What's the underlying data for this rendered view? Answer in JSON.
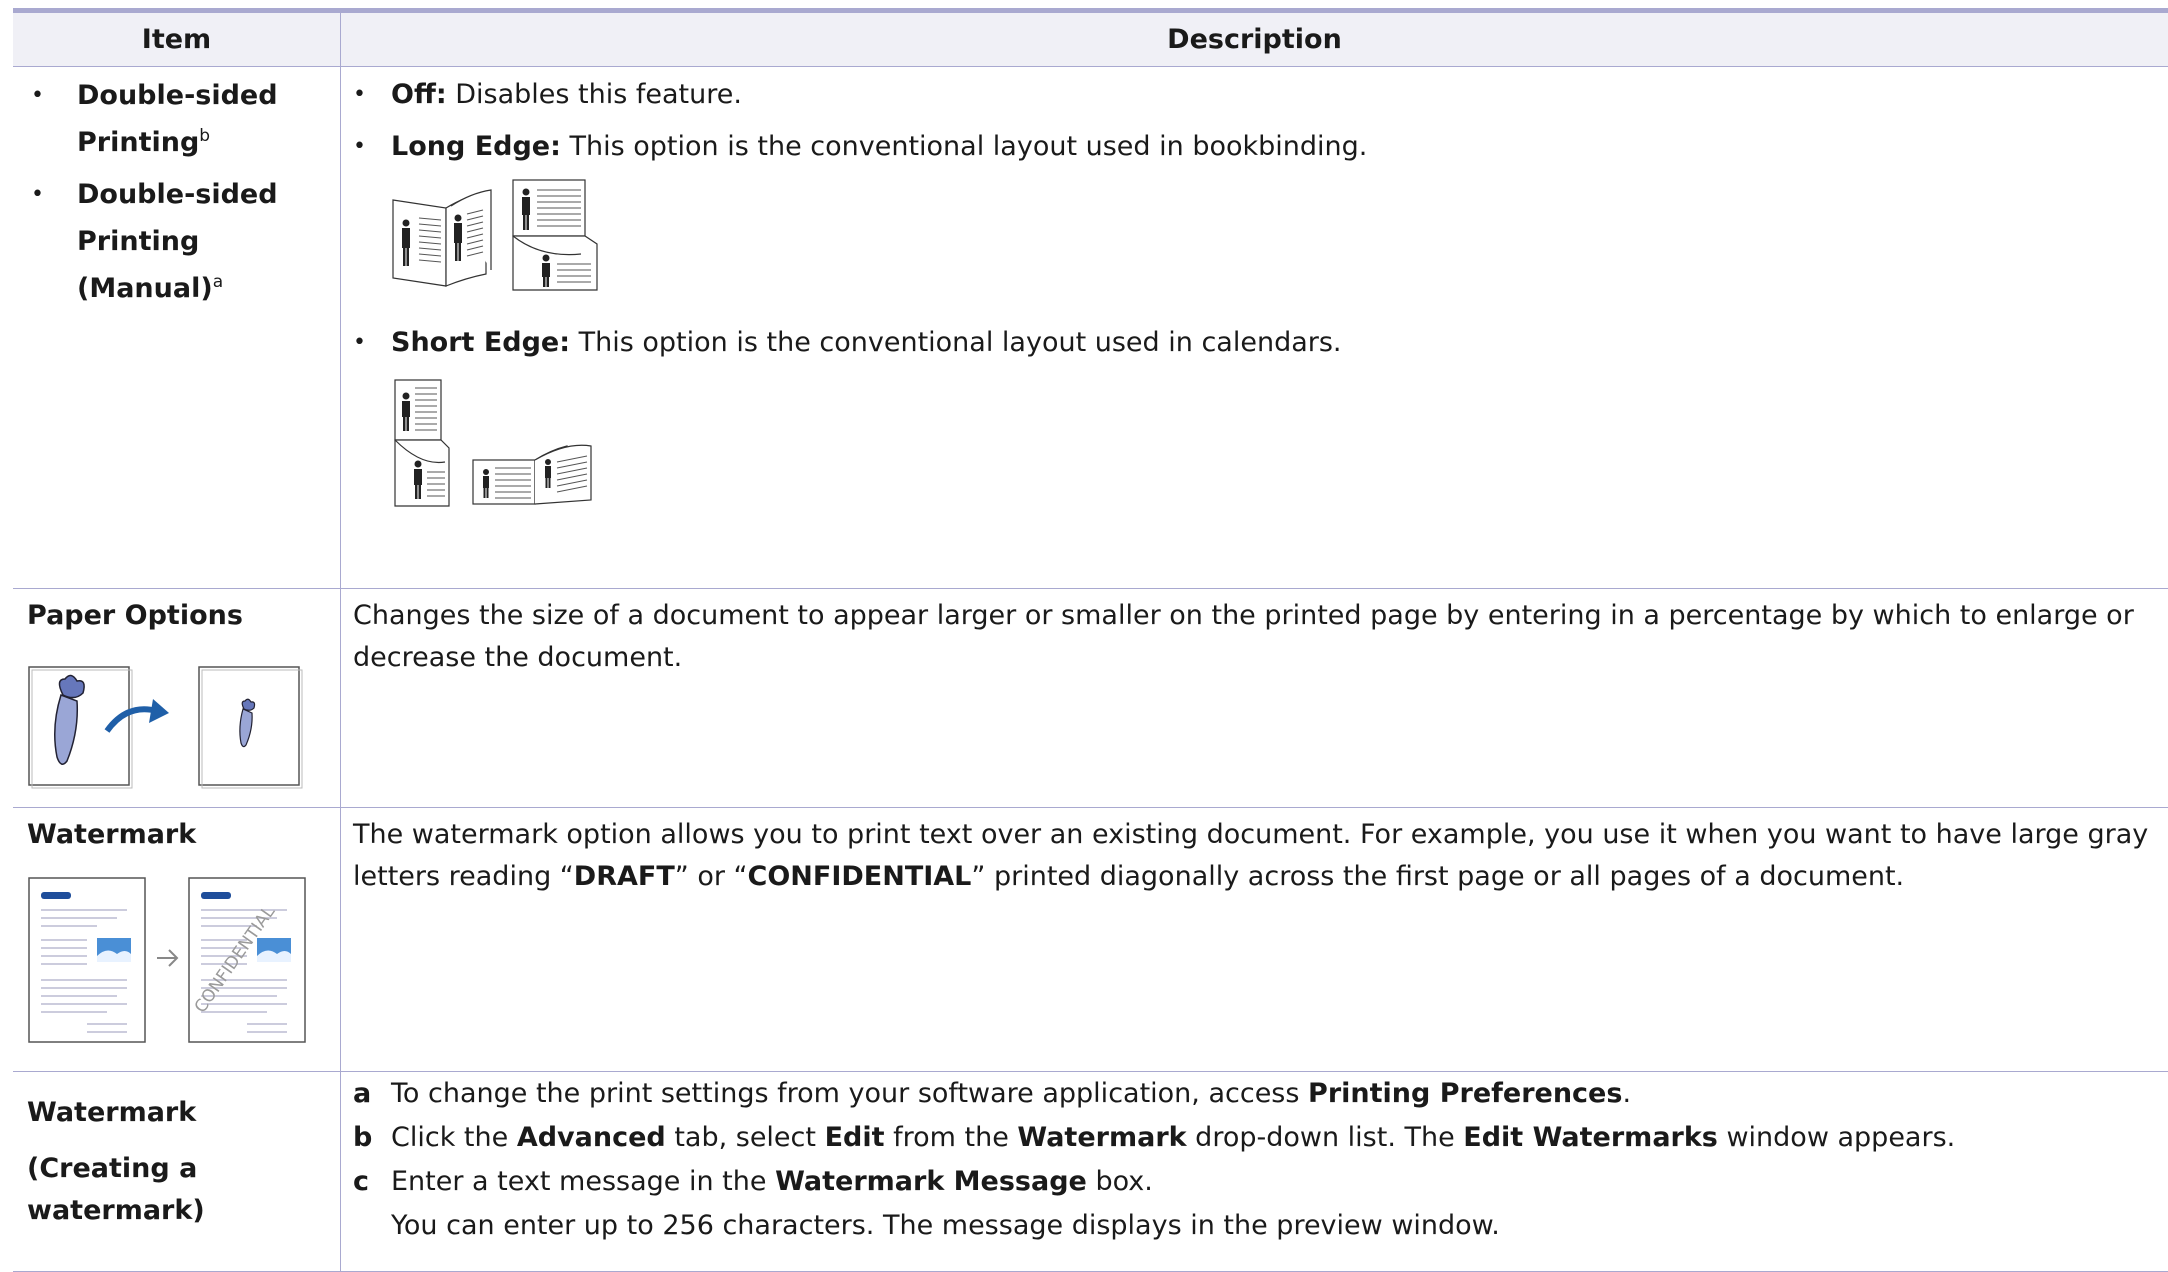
{
  "table": {
    "headers": {
      "item": "Item",
      "description": "Description"
    },
    "row_duplex": {
      "item_1": "Double-sided Printing",
      "item_1_sup": "b",
      "item_2": "Double-sided Printing (Manual)",
      "item_2_sup": "a",
      "off_label": "Off:",
      "off_text": " Disables this feature.",
      "long_label": "Long Edge:",
      "long_text": " This option is the conventional layout used in bookbinding.",
      "short_label": "Short Edge:",
      "short_text": " This option is the conventional layout used in calendars."
    },
    "row_paper": {
      "item": "Paper Options",
      "text": "Changes the size of a document to appear larger or smaller on the printed page by entering in a percentage by which to enlarge or decrease the document."
    },
    "row_watermark": {
      "item": "Watermark",
      "text_1": "The watermark option allows you to print text over an existing document. For example, you use it when you want to have large gray letters reading “",
      "draft": "DRAFT",
      "text_2": "” or “",
      "confidential": "CONFIDENTIAL",
      "text_3": "” printed diagonally across the first page or all pages of a document.",
      "figure_watermark_text": "CONFIDENTIAL"
    },
    "row_create": {
      "item_1": "Watermark",
      "item_2": "(Creating a watermark)",
      "steps": [
        {
          "letter": "a",
          "pre": "To change the print settings from your software application, access ",
          "b1": "Printing Preferences",
          "mid": ".",
          "b2": "",
          "post": ""
        },
        {
          "letter": "b",
          "pre": "Click the ",
          "b1": "Advanced",
          "mid": " tab, select ",
          "b2": "Edit",
          "post": " from the "
        },
        {
          "letter": "c",
          "pre": "Enter a text message in the ",
          "b1": "Watermark Message",
          "mid": " box.",
          "b2": "",
          "post": ""
        }
      ],
      "step_b_b3": "Watermark",
      "step_b_mid2": " drop-down list. The ",
      "step_b_b4": "Edit Watermarks",
      "step_b_end": " window appears.",
      "note": "You can enter up to 256 characters. The message displays in the preview window."
    }
  },
  "colors": {
    "rule": "#a9a9d0",
    "header_bg": "#f0f0f6",
    "arrow": "#1f5fa8",
    "carrot": "#9aa6d6"
  }
}
